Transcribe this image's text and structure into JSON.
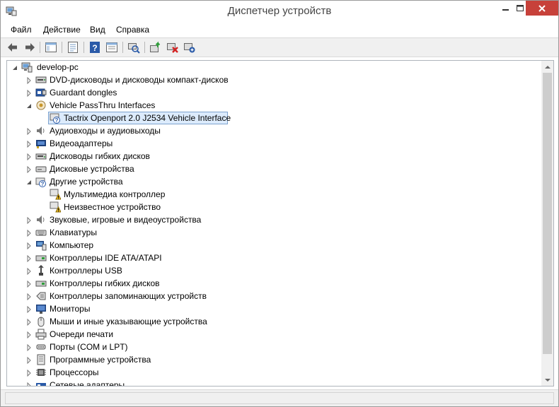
{
  "window": {
    "title": "Диспетчер устройств"
  },
  "menu": {
    "items": [
      "Файл",
      "Действие",
      "Вид",
      "Справка"
    ]
  },
  "toolbar": {
    "buttons": [
      "back-icon",
      "forward-icon",
      "show-hide-console-tree-icon",
      "properties-icon",
      "help-icon",
      "action-pane-icon",
      "scan-hardware-icon",
      "update-driver-icon",
      "uninstall-icon",
      "enable-device-icon"
    ]
  },
  "tree": {
    "root": "develop-pc",
    "items": [
      {
        "label": "DVD-дисководы и дисководы компакт-дисков",
        "icon": "dvd-drive-icon",
        "expanded": false
      },
      {
        "label": "Guardant dongles",
        "icon": "dongle-icon",
        "expanded": false
      },
      {
        "label": "Vehicle PassThru Interfaces",
        "icon": "vehicle-interface-icon",
        "expanded": true,
        "children": [
          {
            "label": "Tactrix Openport 2.0 J2534 Vehicle Interface",
            "icon": "unknown-device-icon",
            "selected": true
          }
        ]
      },
      {
        "label": "Аудиовходы и аудиовыходы",
        "icon": "speaker-icon",
        "expanded": false
      },
      {
        "label": "Видеоадаптеры",
        "icon": "display-adapter-icon",
        "expanded": false
      },
      {
        "label": "Дисководы гибких дисков",
        "icon": "floppy-drive-icon",
        "expanded": false
      },
      {
        "label": "Дисковые устройства",
        "icon": "disk-drive-icon",
        "expanded": false
      },
      {
        "label": "Другие устройства",
        "icon": "other-devices-icon",
        "expanded": true,
        "children": [
          {
            "label": "Мультимедиа контроллер",
            "icon": "warning-device-icon"
          },
          {
            "label": "Неизвестное устройство",
            "icon": "warning-device-icon"
          }
        ]
      },
      {
        "label": "Звуковые, игровые и видеоустройства",
        "icon": "sound-icon",
        "expanded": false
      },
      {
        "label": "Клавиатуры",
        "icon": "keyboard-icon",
        "expanded": false
      },
      {
        "label": "Компьютер",
        "icon": "computer-icon",
        "expanded": false
      },
      {
        "label": "Контроллеры IDE ATA/ATAPI",
        "icon": "ide-controller-icon",
        "expanded": false
      },
      {
        "label": "Контроллеры USB",
        "icon": "usb-icon",
        "expanded": false
      },
      {
        "label": "Контроллеры гибких дисков",
        "icon": "floppy-controller-icon",
        "expanded": false
      },
      {
        "label": "Контроллеры запоминающих устройств",
        "icon": "storage-controller-icon",
        "expanded": false
      },
      {
        "label": "Мониторы",
        "icon": "monitor-icon",
        "expanded": false
      },
      {
        "label": "Мыши и иные указывающие устройства",
        "icon": "mouse-icon",
        "expanded": false
      },
      {
        "label": "Очереди печати",
        "icon": "printer-icon",
        "expanded": false
      },
      {
        "label": "Порты (COM и LPT)",
        "icon": "port-icon",
        "expanded": false
      },
      {
        "label": "Программные устройства",
        "icon": "software-device-icon",
        "expanded": false
      },
      {
        "label": "Процессоры",
        "icon": "processor-icon",
        "expanded": false
      },
      {
        "label": "Сетевые адаптеры",
        "icon": "network-adapter-icon",
        "expanded": false
      }
    ]
  },
  "colors": {
    "close_button": "#c7413a",
    "selection": "#dcebfc",
    "selection_border": "#7da2ce"
  }
}
